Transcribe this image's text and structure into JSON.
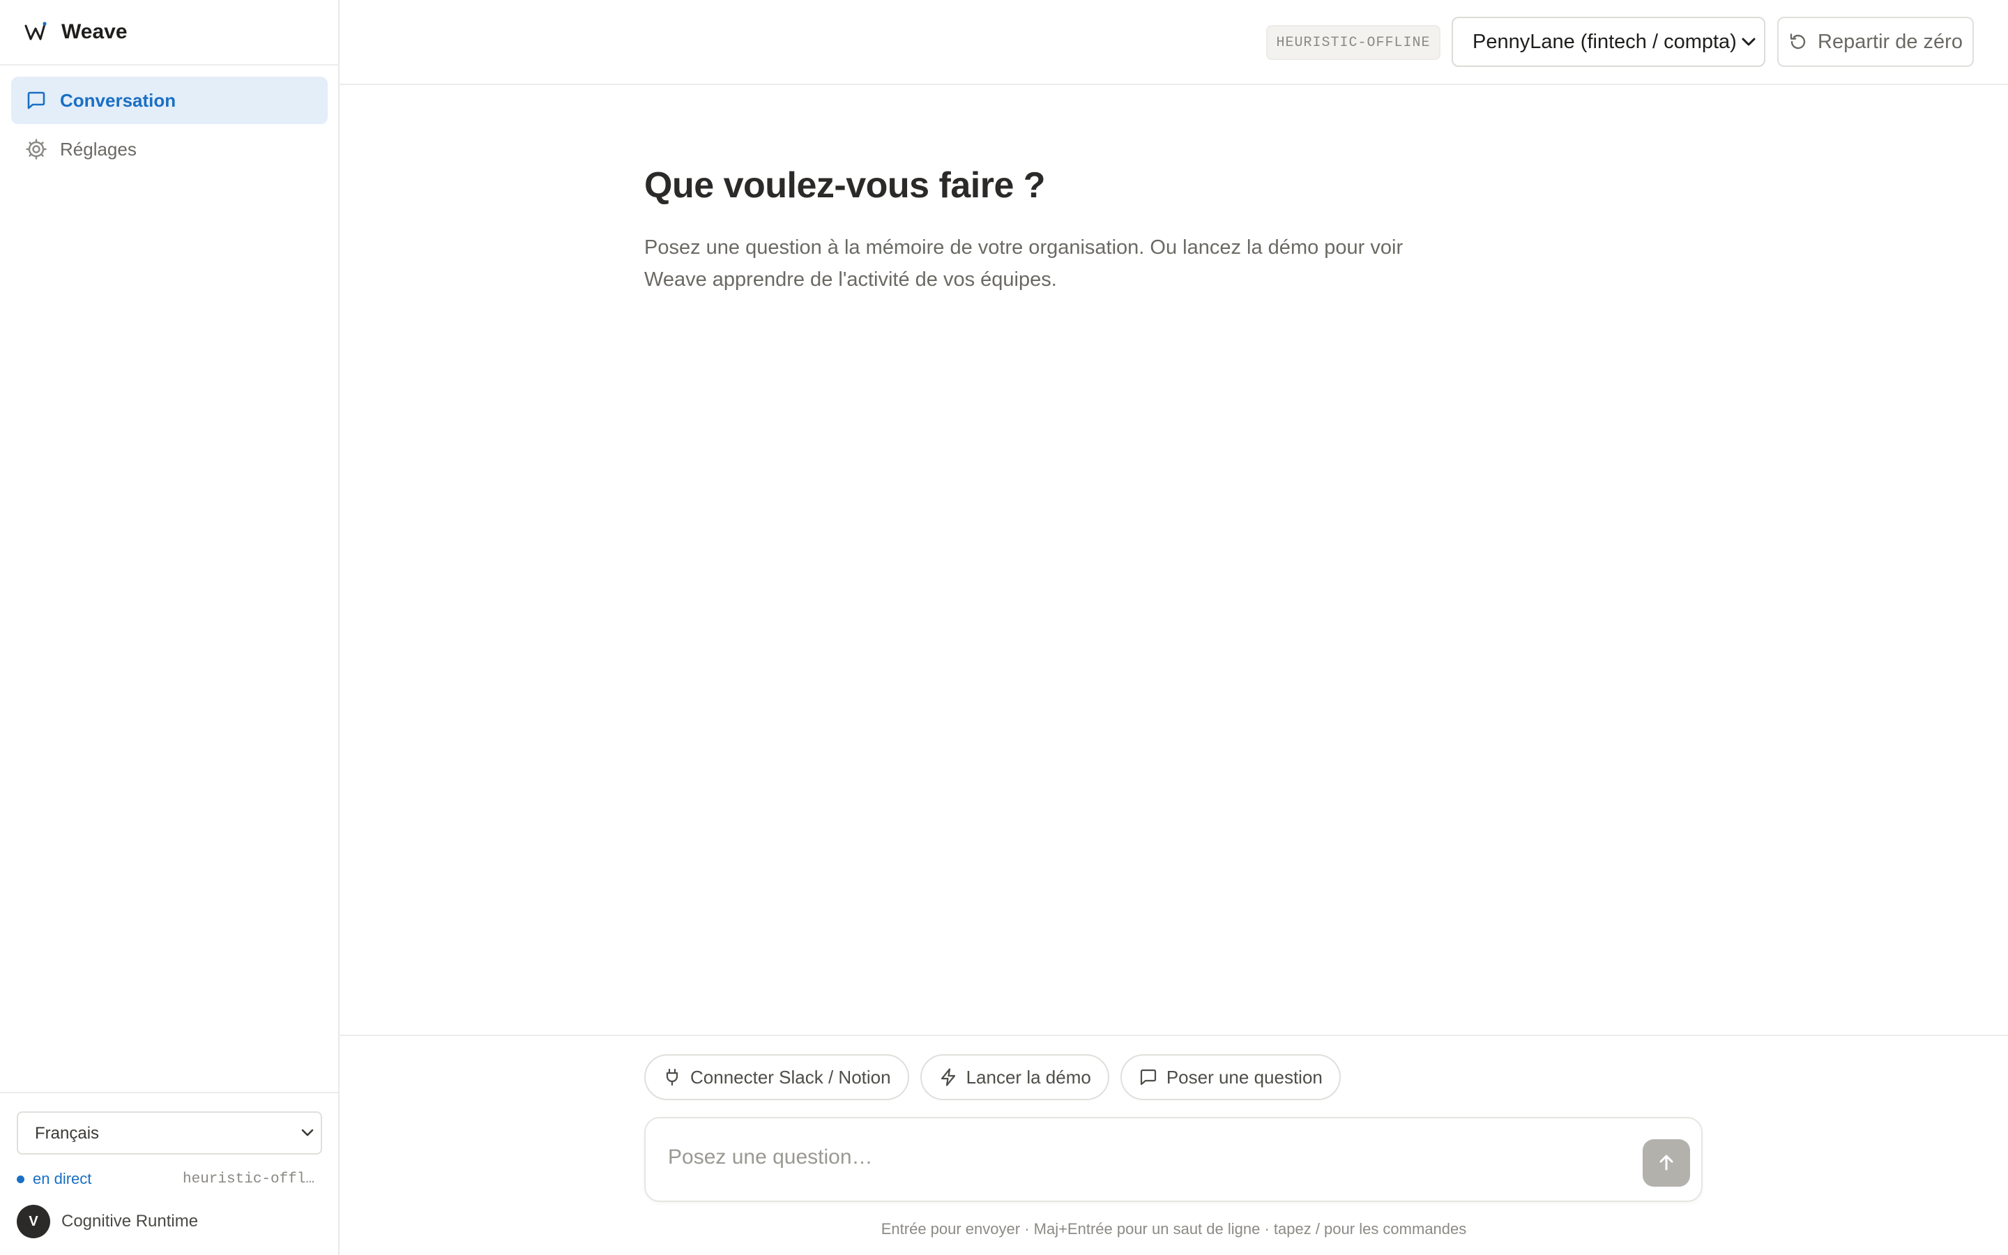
{
  "app": {
    "name": "Weave"
  },
  "sidebar": {
    "items": [
      {
        "label": "Conversation",
        "icon": "message-square-icon",
        "active": true
      },
      {
        "label": "Réglages",
        "icon": "gear-icon",
        "active": false
      }
    ],
    "footer": {
      "language": {
        "selected": "Français"
      },
      "status": {
        "label": "en direct",
        "engine": "heuristic-offline"
      },
      "user": {
        "initial": "V",
        "name": "Cognitive Runtime"
      }
    }
  },
  "header": {
    "engine_badge": "HEURISTIC-OFFLINE",
    "org_select": {
      "selected": "PennyLane (fintech / compta)"
    },
    "reset_label": "Repartir de zéro"
  },
  "main": {
    "title": "Que voulez-vous faire ?",
    "subtitle": "Posez une question à la mémoire de votre organisation. Ou lancez la démo pour voir Weave apprendre de l'activité de vos équipes."
  },
  "composer": {
    "chips": [
      {
        "label": "Connecter Slack / Notion",
        "icon": "plug-icon"
      },
      {
        "label": "Lancer la démo",
        "icon": "zap-icon"
      },
      {
        "label": "Poser une question",
        "icon": "message-square-icon"
      }
    ],
    "placeholder": "Posez une question…",
    "hint": "Entrée pour envoyer · Maj+Entrée pour un saut de ligne · tapez / pour les commandes"
  },
  "colors": {
    "accent": "#1a6fc4",
    "active_bg": "#e4eef9",
    "send_disabled": "#b3b1ac",
    "border": "#e0dfdb"
  }
}
